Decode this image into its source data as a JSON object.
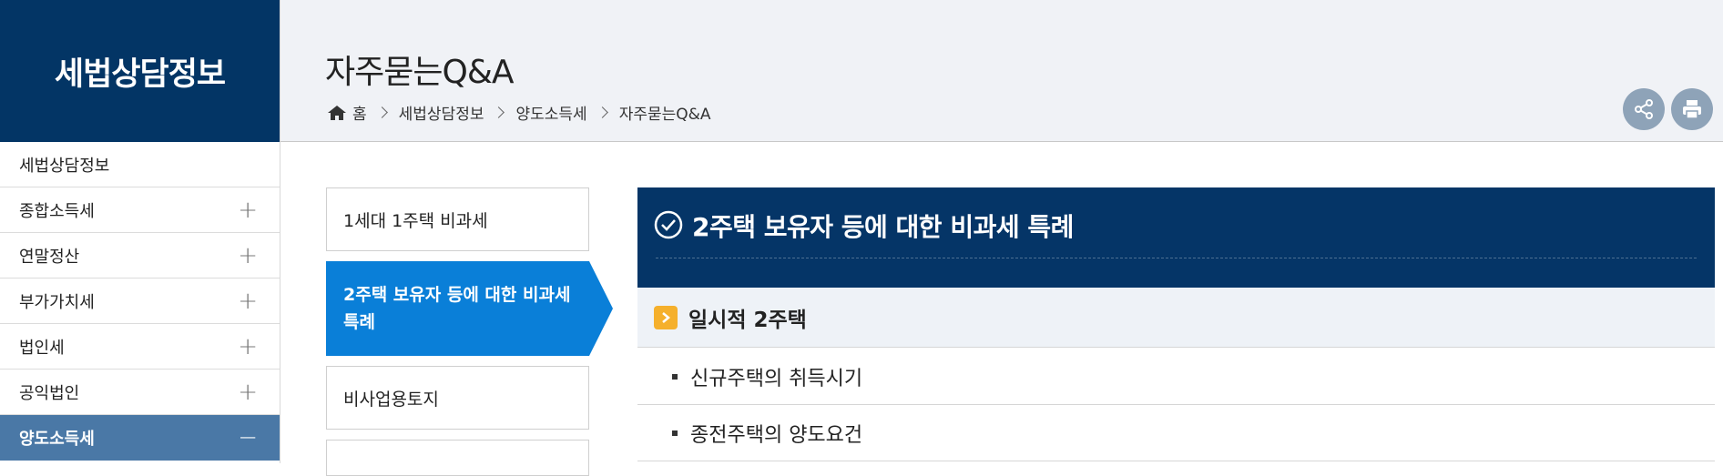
{
  "sidebar": {
    "title": "세법상담정보",
    "items": [
      {
        "label": "세법상담정보",
        "toggle": ""
      },
      {
        "label": "종합소득세",
        "toggle": "+"
      },
      {
        "label": "연말정산",
        "toggle": "+"
      },
      {
        "label": "부가가치세",
        "toggle": "+"
      },
      {
        "label": "법인세",
        "toggle": "+"
      },
      {
        "label": "공익법인",
        "toggle": "+"
      },
      {
        "label": "양도소득세",
        "toggle": "−"
      }
    ]
  },
  "header": {
    "title": "자주묻는Q&A",
    "breadcrumb": [
      "홈",
      "세법상담정보",
      "양도소득세",
      "자주묻는Q&A"
    ],
    "share_icon": "share-icon",
    "print_icon": "print-icon"
  },
  "tabs": [
    {
      "label": "1세대 1주택 비과세"
    },
    {
      "label": "2주택 보유자 등에 대한 비과세 특례"
    },
    {
      "label": "비사업용토지"
    },
    {
      "label": ""
    }
  ],
  "content": {
    "title": "2주택 보유자 등에 대한 비과세 특례",
    "section_title": "일시적 2주택",
    "items": [
      "신규주택의 취득시기",
      "종전주택의 양도요건"
    ]
  },
  "colors": {
    "navy": "#033565",
    "active_tab": "#0a7fd8",
    "sidebar_active": "#4a78a6",
    "accent": "#f5b02c"
  }
}
